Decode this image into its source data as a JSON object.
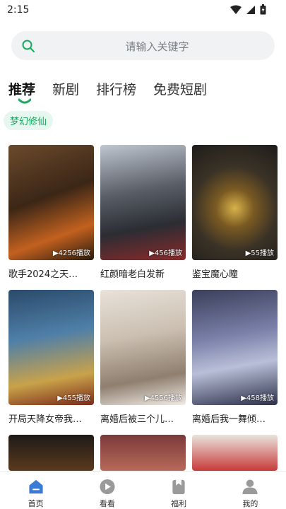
{
  "status": {
    "time": "2:15"
  },
  "search": {
    "placeholder": "请输入关键字"
  },
  "tabs": [
    {
      "label": "推荐",
      "active": true
    },
    {
      "label": "新剧"
    },
    {
      "label": "排行榜"
    },
    {
      "label": "免费短剧"
    }
  ],
  "chip": {
    "label": "梦幻修仙"
  },
  "dramas": [
    {
      "title": "歌手2024之天…",
      "plays": "▶4256播放"
    },
    {
      "title": "红颜暗老白发新",
      "plays": "▶456播放"
    },
    {
      "title": "鉴宝魔心瞳",
      "plays": "▶55播放"
    },
    {
      "title": "开局天降女帝我…",
      "plays": "▶455播放"
    },
    {
      "title": "离婚后被三个儿…",
      "plays": "▶4556播放"
    },
    {
      "title": "离婚后我一舞倾…",
      "plays": "▶458播放"
    }
  ],
  "nav": [
    {
      "label": "首页",
      "icon": "home-icon",
      "active": true
    },
    {
      "label": "看看",
      "icon": "play-icon"
    },
    {
      "label": "福利",
      "icon": "gift-icon"
    },
    {
      "label": "我的",
      "icon": "user-icon"
    }
  ],
  "colors": {
    "accent": "#1aa85f",
    "nav_active": "#3a7bd5",
    "nav_inactive": "#9a9a9a"
  }
}
